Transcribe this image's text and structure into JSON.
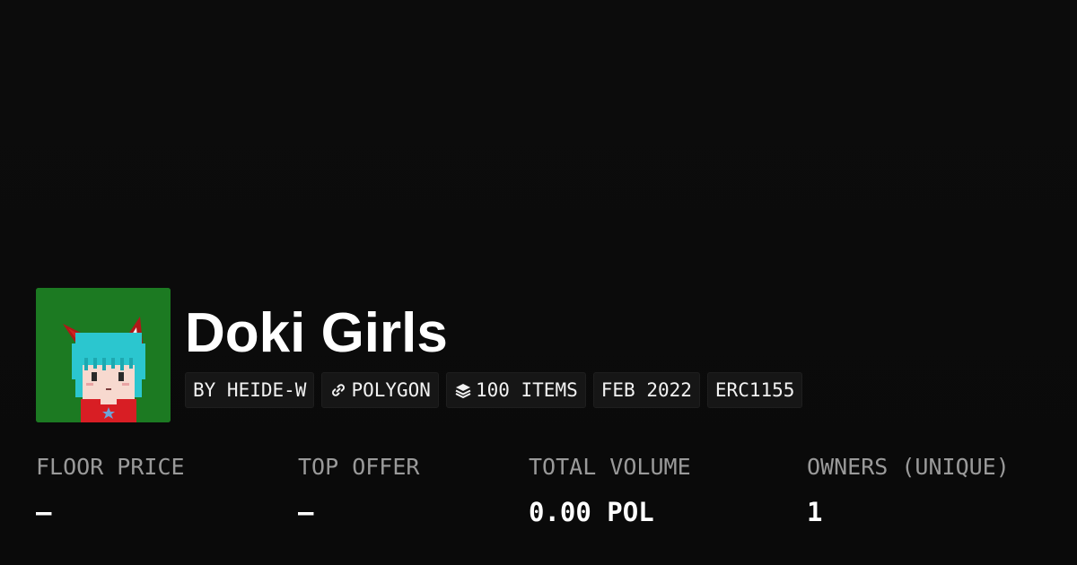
{
  "collection": {
    "name": "Doki Girls",
    "avatar_icon": "doki-girl-pixel-avatar",
    "avatar_bg_color": "#1c7a22"
  },
  "tags": {
    "creator": "BY HEIDE-W",
    "chain": "POLYGON",
    "chain_icon": "link-icon",
    "items": "100 ITEMS",
    "items_icon": "layers-icon",
    "created": "FEB 2022",
    "standard": "ERC1155"
  },
  "stats": {
    "floor_price": {
      "label": "FLOOR PRICE",
      "value": "–"
    },
    "top_offer": {
      "label": "TOP OFFER",
      "value": "–"
    },
    "total_volume": {
      "label": "TOTAL VOLUME",
      "value": "0.00 POL"
    },
    "owners": {
      "label": "OWNERS (UNIQUE)",
      "value": "1"
    }
  },
  "colors": {
    "background": "#0b0b0b",
    "tag_background": "#161616",
    "label_text": "#9a9a9a",
    "value_text": "#ffffff"
  }
}
